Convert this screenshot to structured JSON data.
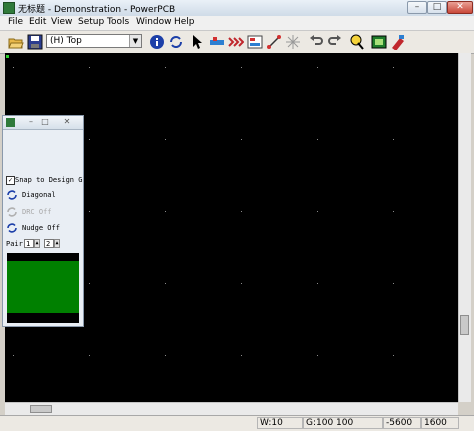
{
  "window": {
    "title": "无标题 - Demonstration - PowerPCB"
  },
  "menu": [
    "File",
    "Edit",
    "View",
    "Setup",
    "Tools",
    "Window",
    "Help"
  ],
  "toolbar": {
    "layer_value": "(H) Top",
    "icons": [
      "open-icon",
      "save-icon",
      "info-icon",
      "redraw-icon",
      "select-icon",
      "design-toolbar-icon",
      "ecr-toolbar-icon",
      "drafting-toolbar-icon",
      "dimension-toolbar-icon",
      "bga-toolbar-icon",
      "undo-icon",
      "redo-icon",
      "zoom-icon",
      "layout-icon",
      "cam-icon"
    ]
  },
  "panel": {
    "snap_label": "Snap to Design G",
    "snap_checked": true,
    "angle_label": "Diagonal",
    "drc_label": "DRC Off",
    "nudge_label": "Nudge Off",
    "pair_label": "Pair",
    "pair_value_1": "1",
    "pair_value_2": "2"
  },
  "status": {
    "width": "W:10",
    "grid": "G:100 100",
    "x": "-5600",
    "y": "1600"
  },
  "colors": {
    "canvas": "#000000",
    "preview_fill": "#008000"
  }
}
